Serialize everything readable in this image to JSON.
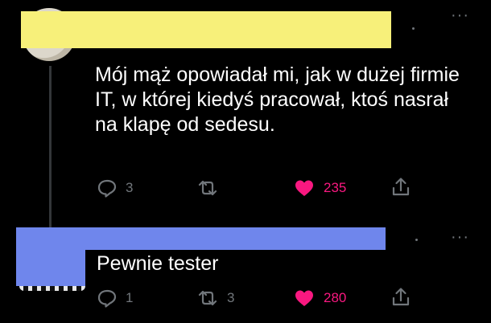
{
  "tweets": [
    {
      "text": "Mój mąż opowiadał mi, jak w dużej firmie IT, w której kiedyś pracował, ktoś nasrał na klapę od sedesu.",
      "actions": {
        "reply_count": "3",
        "retweet_count": "",
        "like_count": "235"
      },
      "liked": true
    },
    {
      "text": "Pewnie tester",
      "actions": {
        "reply_count": "1",
        "retweet_count": "3",
        "like_count": "280"
      },
      "liked": true
    }
  ],
  "icons": {
    "reply": "reply-icon",
    "retweet": "retweet-icon",
    "like": "heart-icon",
    "share": "share-icon",
    "more": "more-icon"
  },
  "colors": {
    "background": "#000000",
    "text": "#ffffff",
    "muted": "#71767b",
    "like": "#f91880",
    "redact_yellow": "#f7f07a",
    "redact_blue": "#6f86ec"
  }
}
